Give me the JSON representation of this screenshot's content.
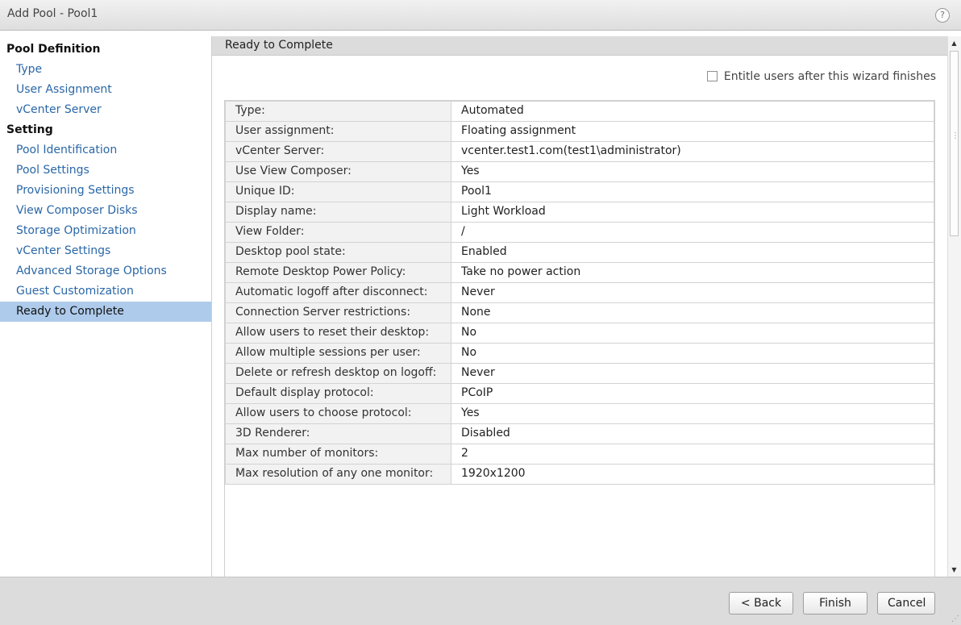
{
  "window": {
    "title": "Add Pool - Pool1",
    "help": "?"
  },
  "sidebar": {
    "sections": [
      {
        "label": "Pool Definition",
        "items": [
          "Type",
          "User Assignment",
          "vCenter Server"
        ]
      },
      {
        "label": "Setting",
        "items": [
          "Pool Identification",
          "Pool Settings",
          "Provisioning Settings",
          "View Composer Disks",
          "Storage Optimization",
          "vCenter Settings",
          "Advanced Storage Options",
          "Guest Customization",
          "Ready to Complete"
        ]
      }
    ],
    "active": "Ready to Complete"
  },
  "main": {
    "header": "Ready to Complete",
    "entitle_label": "Entitle users after this wizard finishes",
    "entitle_checked": false,
    "rows": [
      {
        "label": "Type:",
        "value": "Automated"
      },
      {
        "label": "User assignment:",
        "value": "Floating assignment"
      },
      {
        "label": "vCenter Server:",
        "value": "vcenter.test1.com(test1\\administrator)"
      },
      {
        "label": "Use View Composer:",
        "value": "Yes"
      },
      {
        "label": "Unique ID:",
        "value": "Pool1"
      },
      {
        "label": "Display name:",
        "value": "Light Workload"
      },
      {
        "label": "View Folder:",
        "value": "/"
      },
      {
        "label": "Desktop pool state:",
        "value": "Enabled"
      },
      {
        "label": "Remote Desktop Power Policy:",
        "value": "Take no power action"
      },
      {
        "label": "Automatic logoff after disconnect:",
        "value": "Never"
      },
      {
        "label": "Connection Server restrictions:",
        "value": "None"
      },
      {
        "label": "Allow users to reset their desktop:",
        "value": "No"
      },
      {
        "label": "Allow multiple sessions per user:",
        "value": "No"
      },
      {
        "label": "Delete or refresh desktop on logoff:",
        "value": "Never"
      },
      {
        "label": "Default display protocol:",
        "value": "PCoIP"
      },
      {
        "label": "Allow users to choose protocol:",
        "value": "Yes"
      },
      {
        "label": "3D Renderer:",
        "value": "Disabled"
      },
      {
        "label": "Max number of monitors:",
        "value": "2"
      },
      {
        "label": "Max resolution of any one monitor:",
        "value": "1920x1200"
      }
    ]
  },
  "footer": {
    "back_label": "< Back",
    "finish_label": "Finish",
    "cancel_label": "Cancel"
  }
}
